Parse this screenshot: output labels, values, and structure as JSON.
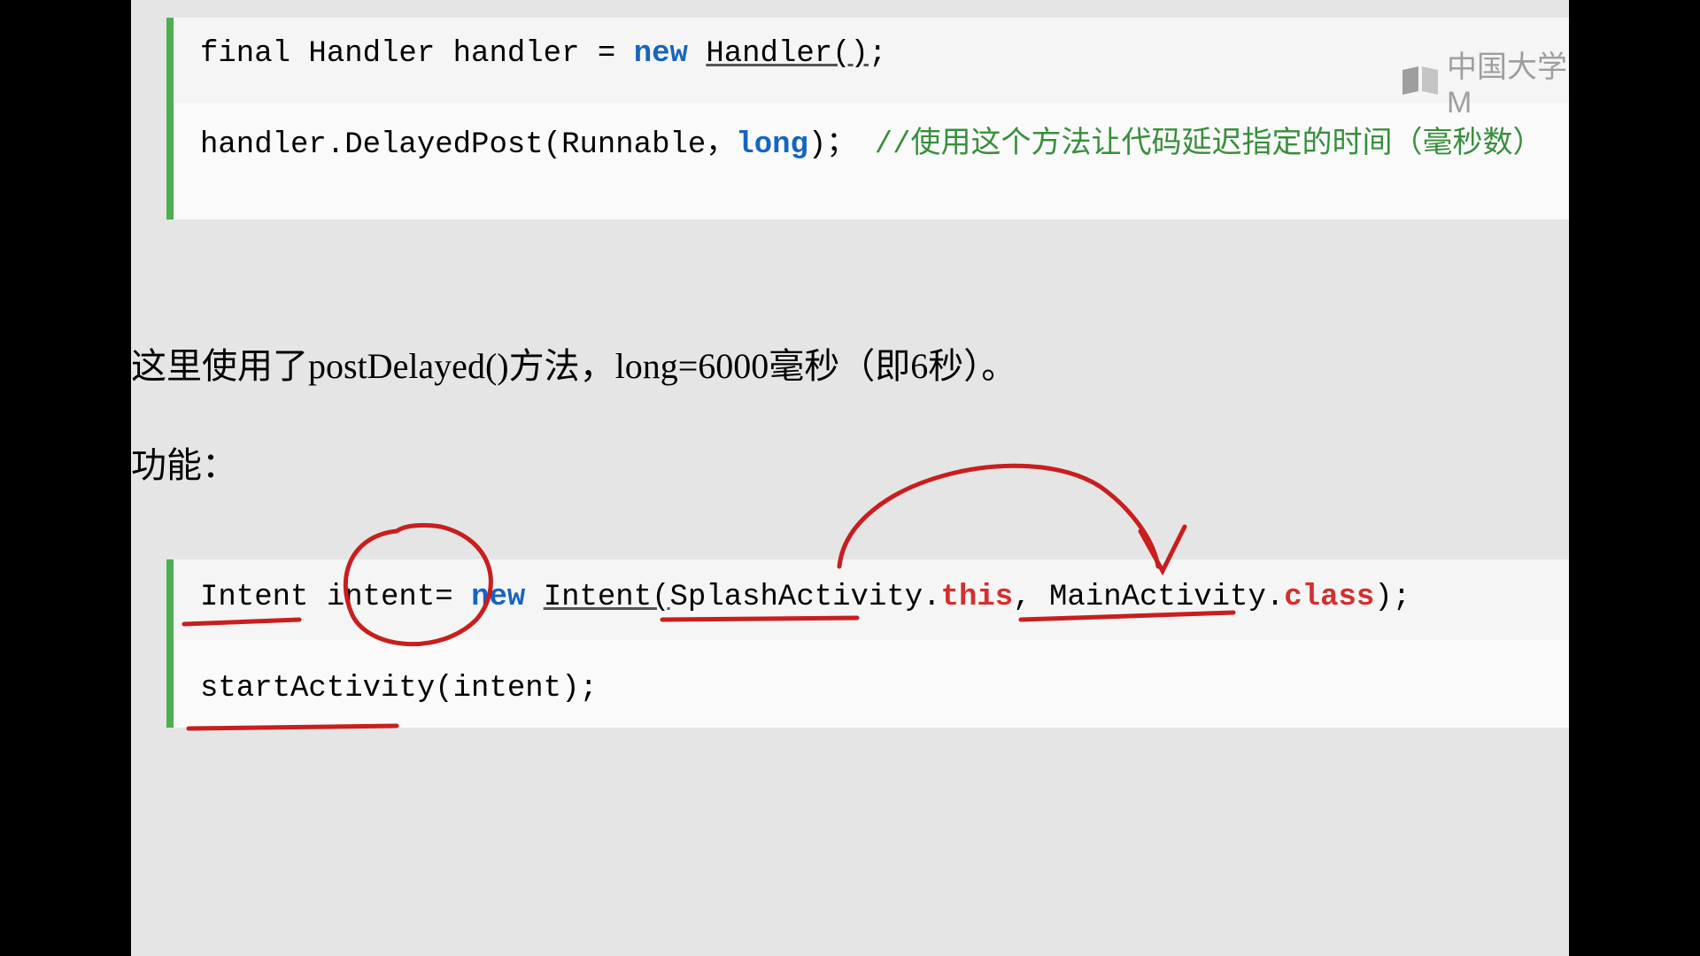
{
  "code1": {
    "prefix": "final Handler handler = ",
    "new": "new",
    "handler_call": "Handler()",
    "semicolon": ";",
    "line2_prefix": "handler.DelayedPost(Runnable，",
    "long": "long",
    "line2_suffix": ")；",
    "comment": "//使用这个方法让代码延迟指定的时间（毫秒数）"
  },
  "para1": "这里使用了postDelayed()方法，long=6000毫秒（即6秒）。",
  "para2": "功能：",
  "code2": {
    "prefix": "Intent intent= ",
    "new": "new",
    "sp": " ",
    "intent": "Intent(",
    "splash": "SplashActivity.",
    "this": "this",
    "comma": ", MainActivity.",
    "class": "class",
    "suffix": ");",
    "line2": "startActivity(intent);"
  },
  "watermark_text": "中国大学M"
}
